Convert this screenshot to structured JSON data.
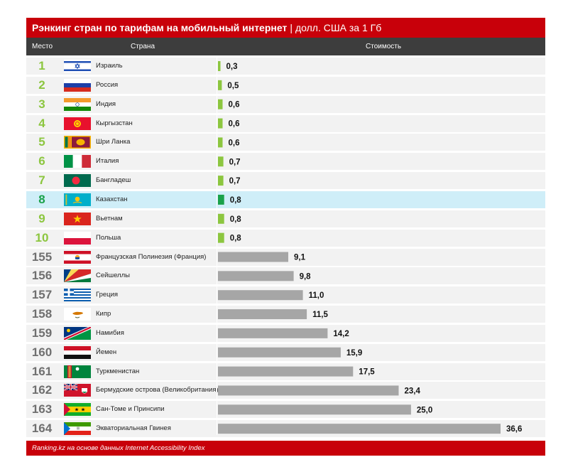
{
  "title": {
    "bold": "Рэнкинг стран по тарифам на мобильный интернет",
    "separator": "|",
    "subtitle": "долл. США за 1 Гб"
  },
  "headers": {
    "rank": "Место",
    "country": "Страна",
    "cost": "Стоимость"
  },
  "footer": "Ranking.kz на основе данных Internet Accessibility Index",
  "colors": {
    "title_bg": "#c8000a",
    "header_bg": "#3d3d3d",
    "top_bar": "#8cc63f",
    "highlight_bar": "#1aa24a",
    "bottom_bar": "#a6a6a6",
    "highlight_row": "#cfeef8",
    "row_bg": "#f2f2f2"
  },
  "chart_data": {
    "type": "bar",
    "orientation": "horizontal",
    "title": "Рэнкинг стран по тарифам на мобильный интернет | долл. США за 1 Гб",
    "rows": [
      {
        "rank": "1",
        "country": "Израиль",
        "value": 0.3,
        "value_label": "0,3",
        "flag": "israel-flag",
        "group": "top"
      },
      {
        "rank": "2",
        "country": "Россия",
        "value": 0.5,
        "value_label": "0,5",
        "flag": "russia-flag",
        "group": "top"
      },
      {
        "rank": "3",
        "country": "Индия",
        "value": 0.6,
        "value_label": "0,6",
        "flag": "india-flag",
        "group": "top"
      },
      {
        "rank": "4",
        "country": "Кыргызстан",
        "value": 0.6,
        "value_label": "0,6",
        "flag": "kyrgyzstan-flag",
        "group": "top"
      },
      {
        "rank": "5",
        "country": "Шри Ланка",
        "value": 0.6,
        "value_label": "0,6",
        "flag": "sri-lanka-flag",
        "group": "top"
      },
      {
        "rank": "6",
        "country": "Италия",
        "value": 0.7,
        "value_label": "0,7",
        "flag": "italy-flag",
        "group": "top"
      },
      {
        "rank": "7",
        "country": "Бангладеш",
        "value": 0.7,
        "value_label": "0,7",
        "flag": "bangladesh-flag",
        "group": "top"
      },
      {
        "rank": "8",
        "country": "Казахстан",
        "value": 0.8,
        "value_label": "0,8",
        "flag": "kazakhstan-flag",
        "group": "highlight"
      },
      {
        "rank": "9",
        "country": "Вьетнам",
        "value": 0.8,
        "value_label": "0,8",
        "flag": "vietnam-flag",
        "group": "top"
      },
      {
        "rank": "10",
        "country": "Польша",
        "value": 0.8,
        "value_label": "0,8",
        "flag": "poland-flag",
        "group": "top"
      },
      {
        "rank": "155",
        "country": "Французская Полинезия (Франция)",
        "value": 9.1,
        "value_label": "9,1",
        "flag": "french-polynesia-flag",
        "group": "bottom"
      },
      {
        "rank": "156",
        "country": "Сейшеллы",
        "value": 9.8,
        "value_label": "9,8",
        "flag": "seychelles-flag",
        "group": "bottom"
      },
      {
        "rank": "157",
        "country": "Греция",
        "value": 11.0,
        "value_label": "11,0",
        "flag": "greece-flag",
        "group": "bottom"
      },
      {
        "rank": "158",
        "country": "Кипр",
        "value": 11.5,
        "value_label": "11,5",
        "flag": "cyprus-flag",
        "group": "bottom"
      },
      {
        "rank": "159",
        "country": "Намибия",
        "value": 14.2,
        "value_label": "14,2",
        "flag": "namibia-flag",
        "group": "bottom"
      },
      {
        "rank": "160",
        "country": "Йемен",
        "value": 15.9,
        "value_label": "15,9",
        "flag": "yemen-flag",
        "group": "bottom"
      },
      {
        "rank": "161",
        "country": "Туркменистан",
        "value": 17.5,
        "value_label": "17,5",
        "flag": "turkmenistan-flag",
        "group": "bottom"
      },
      {
        "rank": "162",
        "country": "Бермудские острова (Великобритания)",
        "value": 23.4,
        "value_label": "23,4",
        "flag": "bermuda-flag",
        "group": "bottom"
      },
      {
        "rank": "163",
        "country": "Сан-Томе и Принсипи",
        "value": 25.0,
        "value_label": "25,0",
        "flag": "sao-tome-flag",
        "group": "bottom"
      },
      {
        "rank": "164",
        "country": "Экваториальная Гвинея",
        "value": 36.6,
        "value_label": "36,6",
        "flag": "equatorial-guinea-flag",
        "group": "bottom"
      }
    ],
    "xlim": [
      0,
      36.6
    ],
    "grid": false,
    "legend": false
  }
}
